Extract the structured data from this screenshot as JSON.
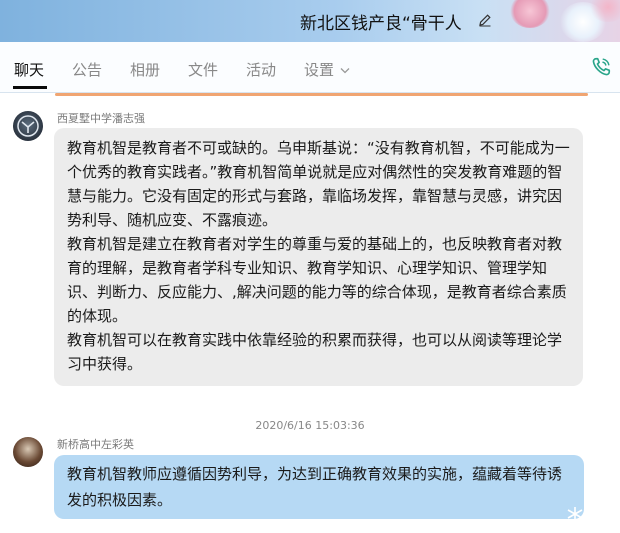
{
  "window": {
    "title": "新北区钱产良“骨干人"
  },
  "tabs": [
    {
      "label": "聊天"
    },
    {
      "label": "公告"
    },
    {
      "label": "相册"
    },
    {
      "label": "文件"
    },
    {
      "label": "活动"
    },
    {
      "label": "设置"
    }
  ],
  "icons": {
    "edit": "pencil-icon",
    "settings_dropdown": "chevron-down-icon",
    "call": "phone-icon"
  },
  "colors": {
    "titlebar": "#8fbbe3",
    "incoming_bubble": "#ececec",
    "outgoing_bubble": "#b6d9f4",
    "accent_line": "#f0a572",
    "phone_icon": "#2aa58a"
  },
  "messages": [
    {
      "sender": "西夏墅中学潘志强",
      "paragraphs": [
        "教育机智是教育者不可或缺的。乌申斯基说：“没有教育机智，不可能成为一个优秀的教育实践者。”教育机智简单说就是应对偶然性的突发教育难题的智慧与能力。它没有固定的形式与套路，靠临场发挥，靠智慧与灵感，讲究因势利导、随机应变、不露痕迹。",
        "教育机智是建立在教育者对学生的尊重与爱的基础上的，也反映教育者对教育的理解，是教育者学科专业知识、教育学知识、心理学知识、管理学知识、判断力、反应能力、,解决问题的能力等的综合体现，是教育者综合素质的体现。",
        "教育机智可以在教育实践中依靠经验的积累而获得，也可以从阅读等理论学习中获得。"
      ]
    },
    {
      "timestamp": "2020/6/16 15:03:36",
      "sender": "新桥高中左彩英",
      "text": "教育机智教师应遵循因势利导，为达到正确教育效果的实施，蕴藏着等待诱发的积极因素。"
    }
  ]
}
